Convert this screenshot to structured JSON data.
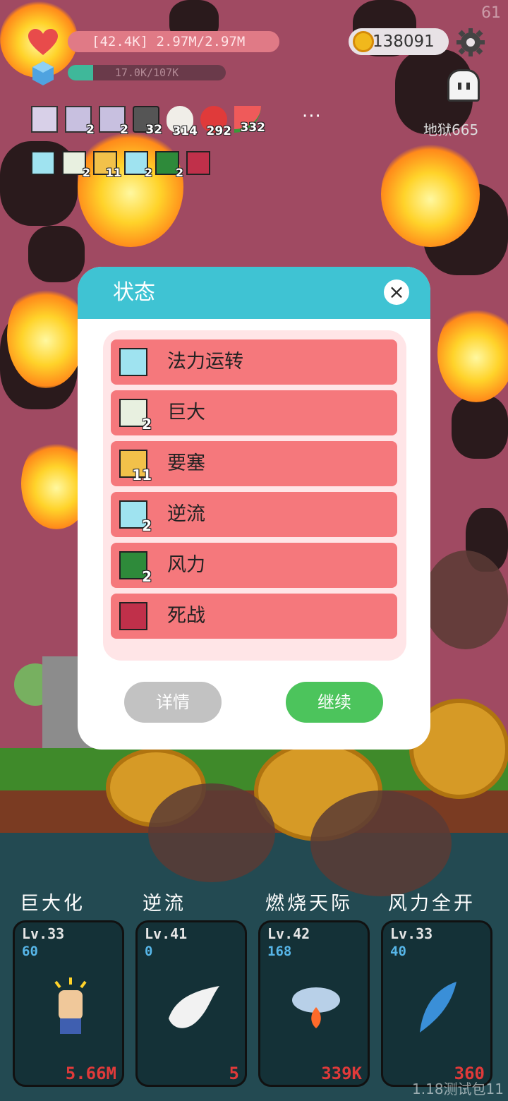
{
  "hud": {
    "fps": "61",
    "hp_text": "[42.4K] 2.97M/2.97M",
    "mp_text": "17.0K/107K",
    "mp_fraction": 0.16,
    "coins": "138091",
    "stage": "地狱665",
    "more": "···"
  },
  "inventory": [
    {
      "icon": "scroll-pink-icon",
      "count": ""
    },
    {
      "icon": "scroll-purple-icon",
      "count": "2"
    },
    {
      "icon": "scroll-purple-icon",
      "count": "2"
    },
    {
      "icon": "trash-can-icon",
      "count": "32"
    },
    {
      "icon": "egg-icon",
      "count": "314"
    },
    {
      "icon": "apple-icon",
      "count": "292"
    },
    {
      "icon": "watermelon-icon",
      "count": "332"
    }
  ],
  "buffs": [
    {
      "icon": "mana-flow-icon",
      "count": ""
    },
    {
      "icon": "giant-icon",
      "count": "2"
    },
    {
      "icon": "fortress-icon",
      "count": "11"
    },
    {
      "icon": "reverse-flow-icon",
      "count": "2"
    },
    {
      "icon": "wind-icon",
      "count": "2"
    },
    {
      "icon": "death-fight-icon",
      "count": ""
    }
  ],
  "modal": {
    "title": "状态",
    "close": "×",
    "rows": [
      {
        "label": "法力运转",
        "count": "",
        "icon": "mana-flow-icon",
        "color": "#9fe3f0"
      },
      {
        "label": "巨大",
        "count": "2",
        "icon": "giant-icon",
        "color": "#e8f0e0"
      },
      {
        "label": "要塞",
        "count": "11",
        "icon": "fortress-icon",
        "color": "#f2c14a"
      },
      {
        "label": "逆流",
        "count": "2",
        "icon": "reverse-flow-icon",
        "color": "#9fe3f0"
      },
      {
        "label": "风力",
        "count": "2",
        "icon": "wind-icon",
        "color": "#2e8a3a"
      },
      {
        "label": "死战",
        "count": "",
        "icon": "death-fight-icon",
        "color": "#c0304a"
      }
    ],
    "detail_button": "详情",
    "continue_button": "继续"
  },
  "skills": [
    {
      "name": "巨大化",
      "level": "Lv.33",
      "points": "60",
      "cost": "5.66M",
      "icon": "raised-fist-icon"
    },
    {
      "name": "逆流",
      "level": "Lv.41",
      "points": "0",
      "cost": "5",
      "icon": "wing-icon"
    },
    {
      "name": "燃烧天际",
      "level": "Lv.42",
      "points": "168",
      "cost": "339K",
      "icon": "fire-cloud-icon"
    },
    {
      "name": "风力全开",
      "level": "Lv.33",
      "points": "40",
      "cost": "360",
      "icon": "feather-icon"
    }
  ],
  "version": "1.18测试包11",
  "colors": {
    "modal_header": "#3fc3d3",
    "row_bg": "#f5787c",
    "continue_btn": "#4cc45c",
    "detail_btn": "#c2c2c2",
    "skill_points": "#57b6e8",
    "skill_cost": "#e03a3a"
  }
}
